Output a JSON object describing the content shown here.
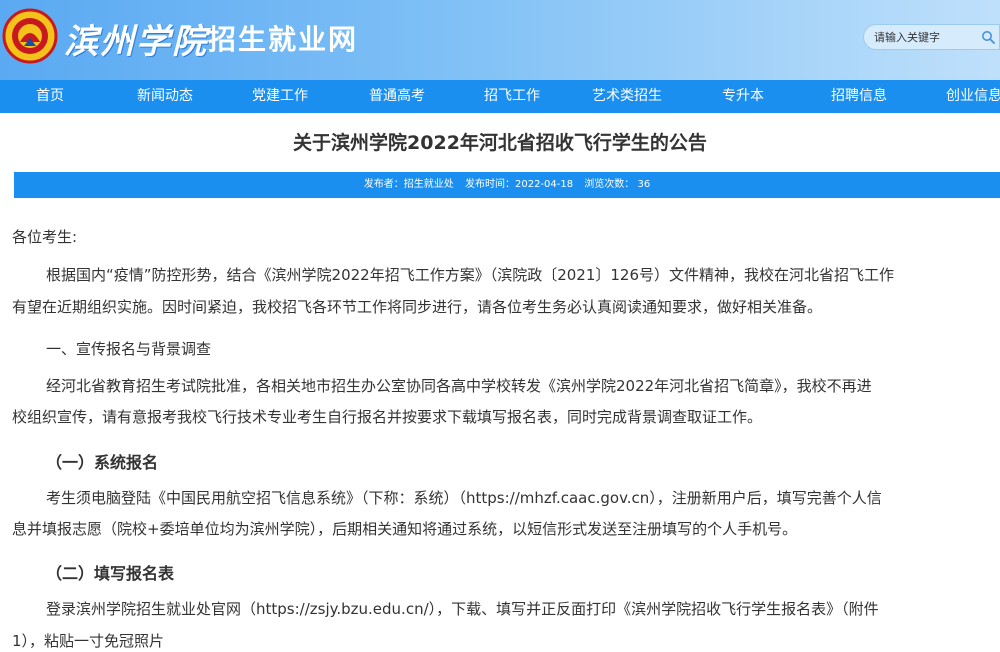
{
  "header": {
    "school_name": "滨州学院",
    "site_title": "招生就业网",
    "search_placeholder": "请输入关键字",
    "colors": {
      "header_bg": "#5aa9f2",
      "nav_bg": "#1b8ff0"
    }
  },
  "nav": {
    "items": [
      {
        "label": "首页"
      },
      {
        "label": "新闻动态"
      },
      {
        "label": "党建工作"
      },
      {
        "label": "普通高考"
      },
      {
        "label": "招飞工作"
      },
      {
        "label": "艺术类招生"
      },
      {
        "label": "专升本"
      },
      {
        "label": "招聘信息"
      },
      {
        "label": "创业信息"
      }
    ]
  },
  "article": {
    "title": "关于滨州学院2022年河北省招收飞行学生的公告",
    "meta": {
      "publisher": "发布者：招生就业处",
      "publish_time": "发布时间：2022-04-18",
      "views": "浏览次数：  36"
    },
    "lines": [
      "各位考生:",
      "根据国内“疫情”防控形势，结合《滨州学院2022年招飞工作方案》（滨院政〔2021〕126号）文件精神，我校在河北省招飞工作",
      "有望在近期组织实施。因时间紧迫，我校招飞各环节工作将同步进行，请各位考生务必认真阅读通知要求，做好相关准备。",
      "一、宣传报名与背景调查",
      "经河北省教育招生考试院批准，各相关地市招生办公室协同各高中学校转发《滨州学院2022年河北省招飞简章》，我校不再进",
      "校组织宣传，请有意报考我校飞行技术专业考生自行报名并按要求下载填写报名表，同时完成背景调查取证工作。",
      "（一）系统报名",
      "考生须电脑登陆《中国民用航空招飞信息系统》（下称：系统）（https://mhzf.caac.gov.cn），注册新用户后，填写完善个人信",
      "息并填报志愿（院校+委培单位均为滨州学院），后期相关通知将通过系统，以短信形式发送至注册填写的个人手机号。",
      "（二）填写报名表",
      "登录滨州学院招生就业处官网（https://zsjy.bzu.edu.cn/），下载、填写并正反面打印《滨州学院招收飞行学生报名表》（附件",
      "1），粘贴一寸免冠照片"
    ]
  }
}
